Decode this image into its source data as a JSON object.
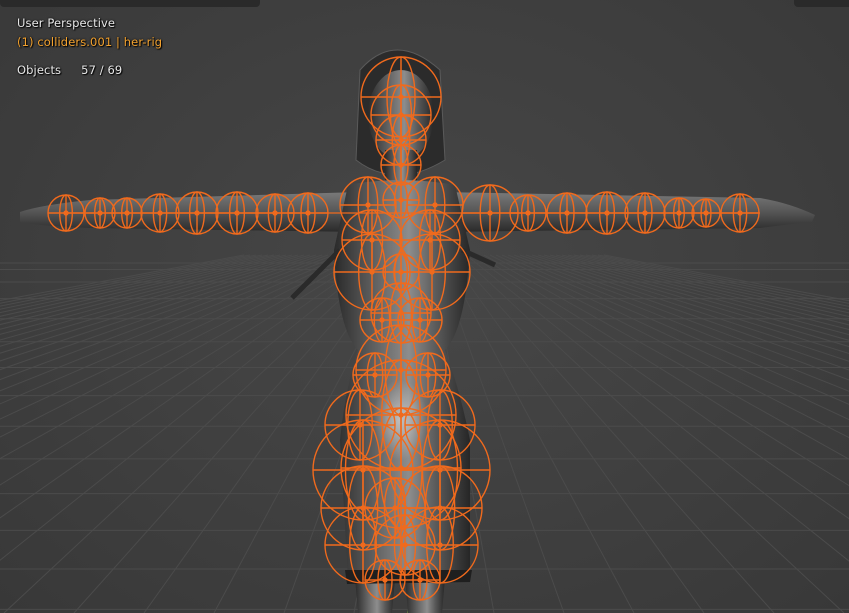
{
  "viewport": {
    "view_label": "User Perspective",
    "active_object": "(1) colliders.001 | her-rig",
    "stats": {
      "label": "Objects",
      "value": "57 / 69"
    }
  },
  "colors": {
    "background": "#3d3d3d",
    "grid": "#4a4a4a",
    "selection_orange": "#f06a1d",
    "active_text": "#f2a12e",
    "text": "#e8e8e8"
  },
  "icons": {
    "colliders": "sphere-collider-wireframe",
    "mesh": "character-mesh"
  }
}
